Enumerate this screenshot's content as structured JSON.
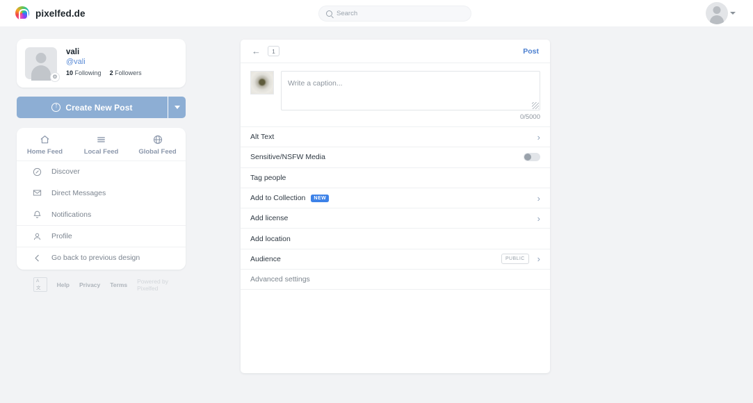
{
  "navbar": {
    "brand": "pixelfed.de",
    "search_placeholder": "Search",
    "search_value": ""
  },
  "sidebar": {
    "profile": {
      "name": "vali",
      "handle": "@vali",
      "following_count": "10",
      "following_label": "Following",
      "followers_count": "2",
      "followers_label": "Followers"
    },
    "create_post_label": "Create New Post",
    "feed_tabs": [
      {
        "label": "Home Feed",
        "icon": "home-icon"
      },
      {
        "label": "Local Feed",
        "icon": "list-icon"
      },
      {
        "label": "Global Feed",
        "icon": "globe-icon"
      }
    ],
    "menu": [
      {
        "label": "Discover",
        "icon": "compass-icon"
      },
      {
        "label": "Direct Messages",
        "icon": "envelope-icon"
      },
      {
        "label": "Notifications",
        "icon": "bell-icon"
      },
      {
        "label": "Profile",
        "icon": "person-icon"
      },
      {
        "label": "Go back to previous design",
        "icon": "chevron-left-icon"
      }
    ],
    "footer": {
      "lang": "A文",
      "help": "Help",
      "privacy": "Privacy",
      "terms": "Terms",
      "powered_by": "Powered by Pixelfed"
    }
  },
  "composer": {
    "media_count": "1",
    "post_label": "Post",
    "caption_placeholder": "Write a caption...",
    "caption_value": "",
    "caption_counter": "0/5000",
    "rows": [
      {
        "label": "Alt Text"
      },
      {
        "label": "Sensitive/NSFW Media"
      },
      {
        "label": "Tag people"
      },
      {
        "label": "Add to Collection",
        "badge": "NEW"
      },
      {
        "label": "Add license"
      },
      {
        "label": "Add location"
      },
      {
        "label": "Audience",
        "value": "PUBLIC"
      },
      {
        "label": "Advanced settings"
      }
    ]
  },
  "colors": {
    "accent_blue": "#3d82e8",
    "brand_button": "#8daed4",
    "page_bg": "#f2f3f5"
  }
}
